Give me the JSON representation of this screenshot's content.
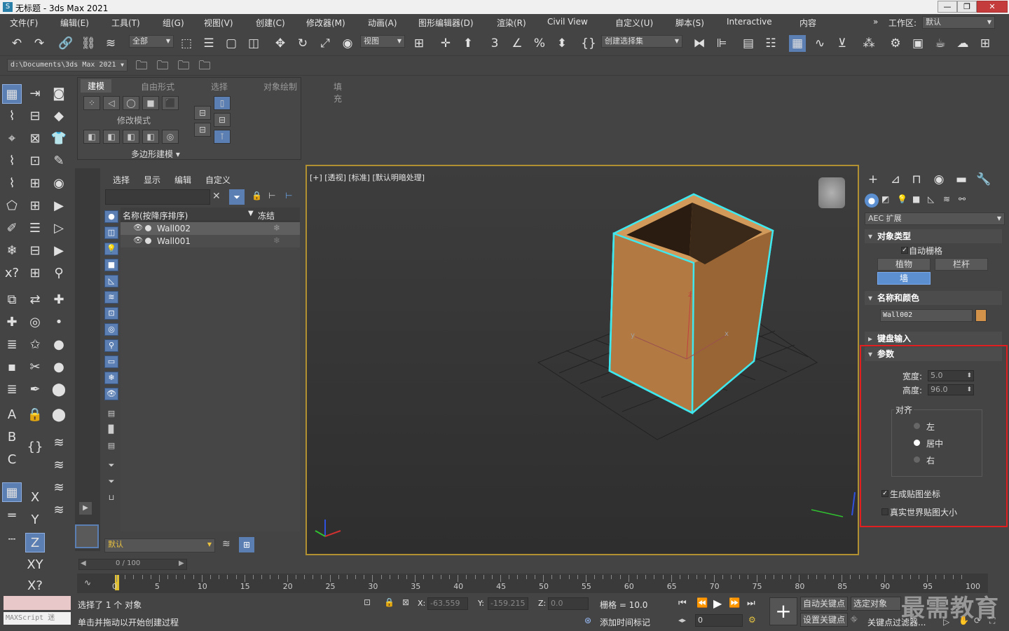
{
  "window": {
    "title": "无标题 - 3ds Max 2021",
    "minimize": "—",
    "maximize": "❐",
    "close": "✕"
  },
  "menu": {
    "items": [
      "文件(F)",
      "编辑(E)",
      "工具(T)",
      "组(G)",
      "视图(V)",
      "创建(C)",
      "修改器(M)",
      "动画(A)",
      "图形编辑器(D)",
      "渲染(R)",
      "Civil View",
      "自定义(U)",
      "脚本(S)",
      "Interactive",
      "内容"
    ],
    "overflow": "»",
    "workspace_label": "工作区:",
    "workspace_value": "默认"
  },
  "toolbar": {
    "selection_filter": "全部",
    "ref_coord": "视图",
    "named_selection": "创建选择集",
    "project_path": "d:\\Documents\\3ds Max 2021"
  },
  "ribbon": {
    "tabs": [
      "建模",
      "自由形式",
      "选择",
      "对象绘制",
      "填充"
    ],
    "group_modify_mode": "修改模式",
    "group_poly": "多边形建模 ▾"
  },
  "explorer": {
    "tabs": [
      "选择",
      "显示",
      "编辑",
      "自定义"
    ],
    "col_name": "名称(按降序排序)",
    "col_freeze": "冻结",
    "rows": [
      {
        "name": "Wall002"
      },
      {
        "name": "Wall001"
      }
    ],
    "layer": "默认",
    "scroll_label": "0 / 100"
  },
  "viewport": {
    "label": "[+] [透视] [标准] [默认明暗处理]",
    "axis_x": "x",
    "axis_y": "y",
    "axis_z": "z"
  },
  "cmdpanel": {
    "category": "AEC 扩展",
    "object_type": {
      "title": "对象类型",
      "autogrid": "自动栅格",
      "buttons": [
        "植物",
        "栏杆",
        "墙"
      ]
    },
    "name_color": {
      "title": "名称和颜色",
      "name": "Wall002",
      "color": "#d2924a"
    },
    "keyboard": {
      "title": "键盘输入"
    },
    "params": {
      "title": "参数",
      "width_label": "宽度:",
      "width": "5.0",
      "height_label": "高度:",
      "height": "96.0",
      "align_label": "对齐",
      "align_options": [
        "左",
        "居中",
        "右"
      ],
      "gen_map": "生成贴图坐标",
      "real_world": "真实世界贴图大小"
    }
  },
  "timeline": {
    "ticks": [
      "0",
      "5",
      "10",
      "15",
      "20",
      "25",
      "30",
      "35",
      "40",
      "45",
      "50",
      "55",
      "60",
      "65",
      "70",
      "75",
      "80",
      "85",
      "90",
      "95",
      "100"
    ]
  },
  "status": {
    "maxscript": "MAXScript 迷",
    "selected": "选择了 1 个 对象",
    "hint": "单击并拖动以开始创建过程",
    "x_label": "X:",
    "x": "-63.559",
    "y_label": "Y:",
    "y": "-159.215",
    "z_label": "Z:",
    "z": "0.0",
    "grid": "栅格 = 10.0",
    "add_time_tag": "添加时间标记",
    "auto_key": "自动关键点",
    "set_key": "设置关键点",
    "selected_obj": "选定对象",
    "key_filters": "关键点过滤器...",
    "frame": "0",
    "watermark": "最需教育"
  },
  "colors": {
    "accent": "#5b8fd0",
    "highlight_border": "#e02020",
    "selection_cyan": "#3fe8ee",
    "box_color": "#c48a4e"
  }
}
